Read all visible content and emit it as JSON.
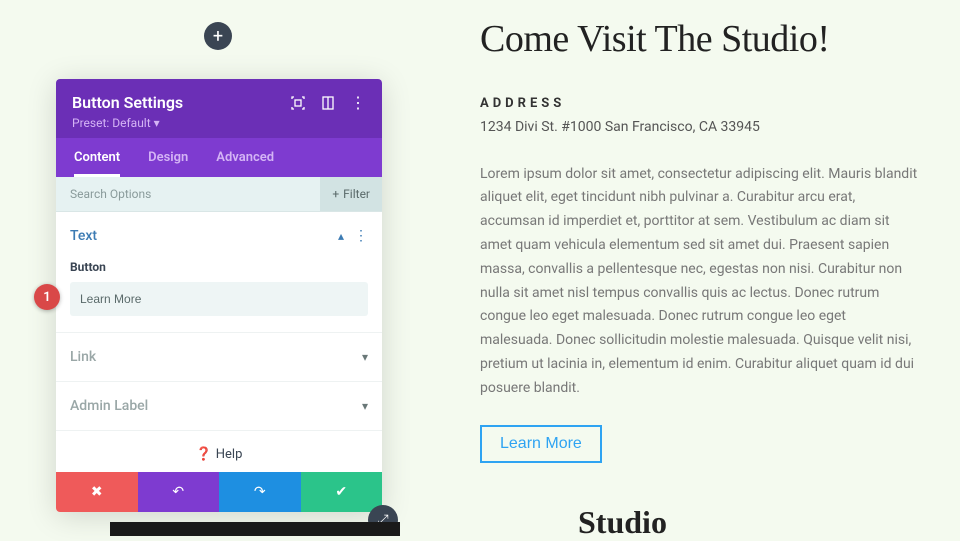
{
  "add_label": "+",
  "panel": {
    "title": "Button Settings",
    "preset": "Preset: Default ▾",
    "tabs": [
      "Content",
      "Design",
      "Advanced"
    ],
    "active_tab": 0,
    "search_placeholder": "Search Options",
    "filter_label": "Filter",
    "sections": {
      "text": {
        "title": "Text",
        "field_label": "Button",
        "field_value": "Learn More"
      },
      "link": {
        "title": "Link"
      },
      "admin": {
        "title": "Admin Label"
      }
    },
    "help_label": "Help"
  },
  "marker": "1",
  "content": {
    "heading": "Come Visit The Studio!",
    "address_label": "ADDRESS",
    "address": "1234 Divi St. #1000 San Francisco, CA 33945",
    "lorem": "Lorem ipsum dolor sit amet, consectetur adipiscing elit. Mauris blandit aliquet elit, eget tincidunt nibh pulvinar a. Curabitur arcu erat, accumsan id imperdiet et, porttitor at sem. Vestibulum ac diam sit amet quam vehicula elementum sed sit amet dui. Praesent sapien massa, convallis a pellentesque nec, egestas non nisi. Curabitur non nulla sit amet nisl tempus convallis quis ac lectus. Donec rutrum congue leo eget malesuada. Donec rutrum congue leo eget malesuada. Donec sollicitudin molestie malesuada. Quisque velit nisi, pretium ut lacinia in, elementum id enim. Curabitur aliquet quam id dui posuere blandit.",
    "cta_label": "Learn More"
  },
  "footer_snippet": "Studio"
}
